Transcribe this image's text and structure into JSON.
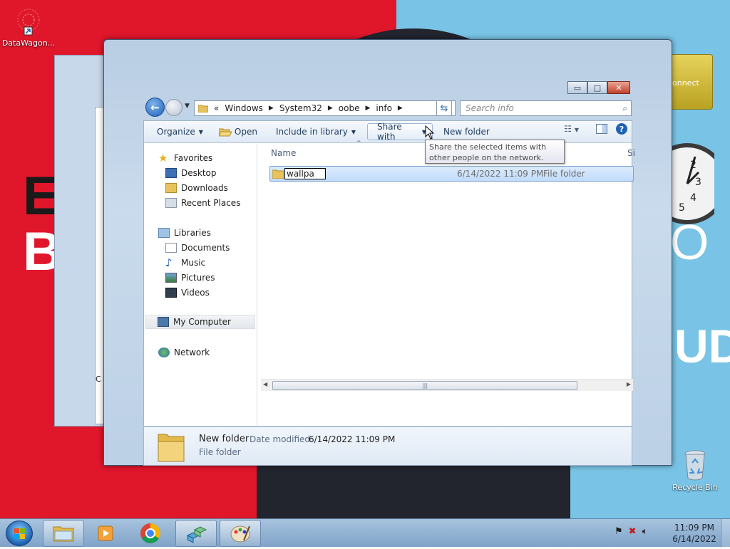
{
  "desktop": {
    "icons": [
      {
        "label": "DataWagon...",
        "icon": "datawagon-shortcut-icon"
      },
      {
        "label": "Recycle Bin",
        "icon": "recycle-bin-icon"
      }
    ],
    "wallpaper_text": {
      "left_line1": "EN",
      "left_line2": "BI",
      "right_o": "O",
      "right_ud": "UD"
    },
    "gadget_connect_text": "onnect",
    "clock_numbers": [
      "2",
      "3",
      "4",
      "5"
    ],
    "bg_window_text": "C"
  },
  "window": {
    "caption": {
      "minimize": "▭",
      "maximize": "□",
      "close": "✕"
    },
    "address": {
      "prefix": "«",
      "crumbs": [
        "Windows",
        "System32",
        "oobe",
        "info"
      ]
    },
    "search_placeholder": "Search info",
    "toolbar": {
      "organize": "Organize",
      "open": "Open",
      "include_in_library": "Include in library",
      "share_with": "Share with",
      "new_folder": "New folder"
    },
    "tooltip": "Share the selected items with other people on the network.",
    "nav": {
      "favorites": "Favorites",
      "desktop": "Desktop",
      "downloads": "Downloads",
      "recent_places": "Recent Places",
      "libraries": "Libraries",
      "documents": "Documents",
      "music": "Music",
      "pictures": "Pictures",
      "videos": "Videos",
      "my_computer": "My Computer",
      "network": "Network"
    },
    "columns": {
      "name": "Name",
      "size": "Si"
    },
    "files": [
      {
        "name_editing": "wallpa",
        "date": "6/14/2022 11:09 PM",
        "type": "File folder"
      }
    ],
    "details": {
      "name": "New folder",
      "date_label": "Date modified:",
      "date_value": "6/14/2022 11:09 PM",
      "type": "File folder"
    }
  },
  "taskbar": {
    "time": "11:09 PM",
    "date": "6/14/2022"
  }
}
